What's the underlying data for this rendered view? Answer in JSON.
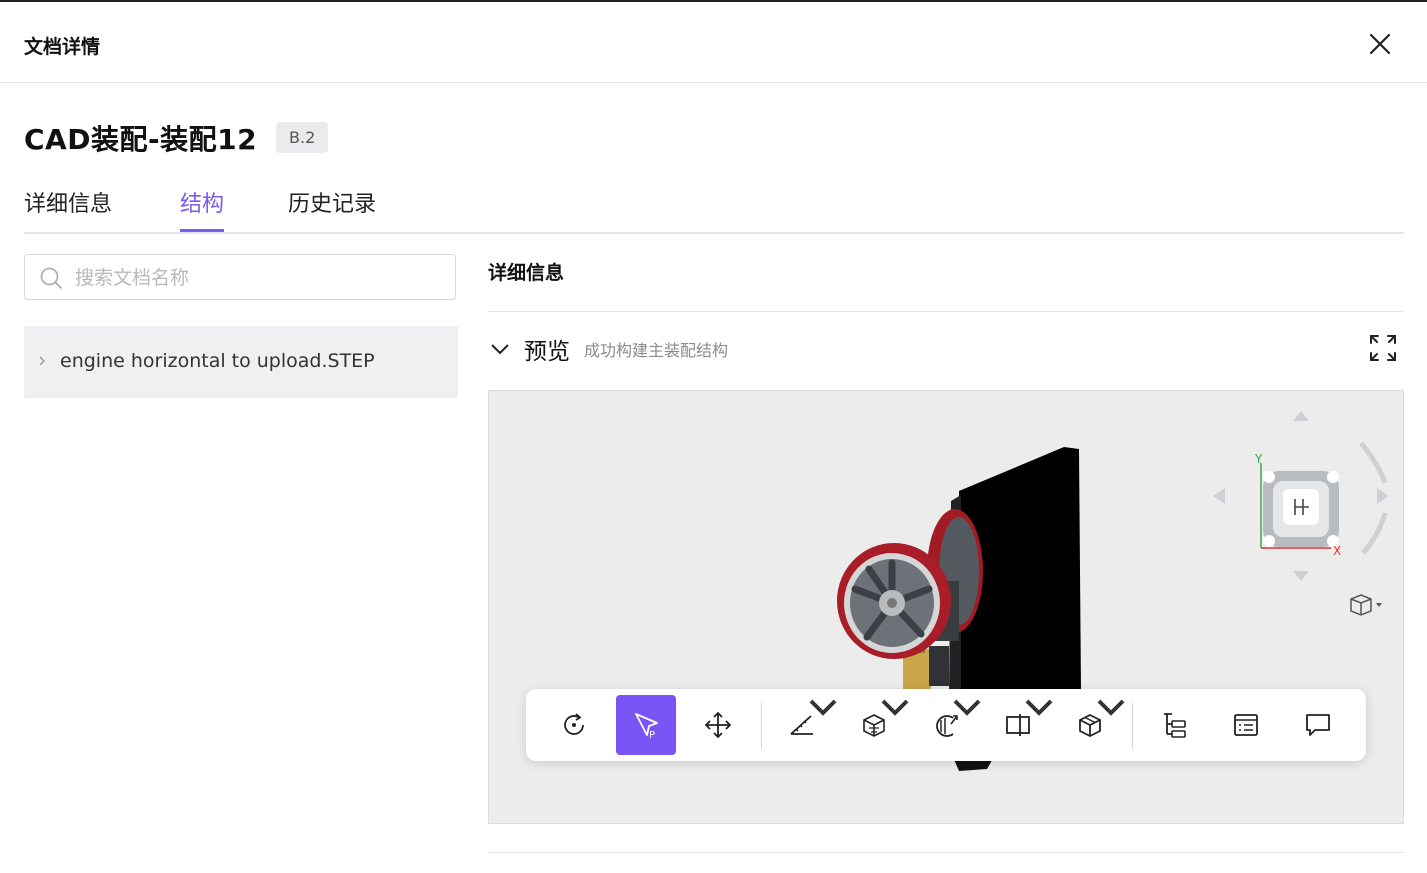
{
  "header": {
    "title": "文档详情"
  },
  "document": {
    "title": "CAD装配-装配12",
    "version": "B.2"
  },
  "tabs": [
    {
      "label": "详细信息",
      "active": false
    },
    {
      "label": "结构",
      "active": true
    },
    {
      "label": "历史记录",
      "active": false
    }
  ],
  "search": {
    "placeholder": "搜索文档名称",
    "value": ""
  },
  "tree": {
    "items": [
      {
        "label": "engine horizontal to upload.STEP",
        "expanded": false
      }
    ]
  },
  "panel": {
    "title": "详细信息",
    "preview": {
      "label": "预览",
      "status": "成功构建主装配结构"
    }
  },
  "navcube": {
    "axis_y": "Y",
    "axis_x": "X"
  },
  "toolbar": {
    "tools": [
      {
        "icon": "rotate-icon",
        "active": false,
        "dropdown": false
      },
      {
        "icon": "select-pointer-icon",
        "active": true,
        "dropdown": false
      },
      {
        "icon": "pan-move-icon",
        "active": false,
        "dropdown": false
      },
      {
        "icon": "measure-ruler-icon",
        "active": false,
        "dropdown": true
      },
      {
        "icon": "explode-view-icon",
        "active": false,
        "dropdown": true
      },
      {
        "icon": "section-cut-icon",
        "active": false,
        "dropdown": true
      },
      {
        "icon": "split-view-icon",
        "active": false,
        "dropdown": true
      },
      {
        "icon": "display-mode-icon",
        "active": false,
        "dropdown": true
      },
      {
        "icon": "model-tree-icon",
        "active": false,
        "dropdown": false
      },
      {
        "icon": "properties-list-icon",
        "active": false,
        "dropdown": false
      },
      {
        "icon": "comment-icon",
        "active": false,
        "dropdown": false
      }
    ]
  },
  "colors": {
    "accent": "#7b5cf0",
    "active_tool": "#7a55f5",
    "viewer_bg": "#ececed",
    "flywheel_red": "#b3202a"
  }
}
